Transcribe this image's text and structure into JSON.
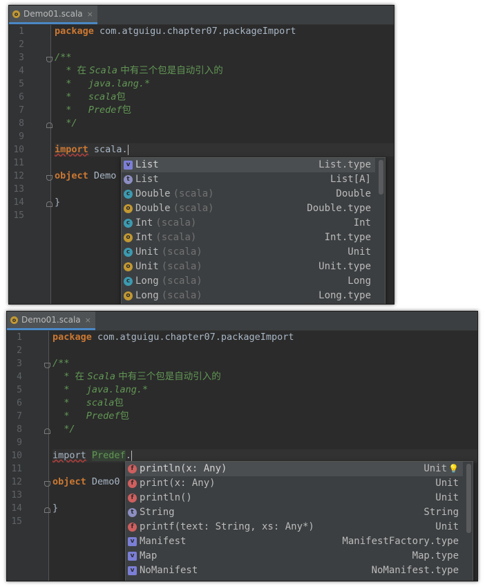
{
  "panels": [
    {
      "tab": {
        "title": "Demo01.scala",
        "icon": "o",
        "close": "×"
      },
      "line_numbers": [
        "1",
        "2",
        "3",
        "4",
        "5",
        "6",
        "7",
        "8",
        "9",
        "10",
        "11",
        "12",
        "13",
        "14",
        "15"
      ],
      "code": {
        "l1_kw": "package",
        "l1_rest": " com.atguigu.chapter07.packageImport",
        "l3": "/**",
        "l4_a": "* ",
        "l4_b": "在 ",
        "l4_c": "Scala",
        "l4_d": " 中有三个包是自动引入的",
        "l5": "*   java.lang.*",
        "l6_a": "*   scala",
        "l6_b": "包",
        "l7_a": "*   Predef",
        "l7_b": "包",
        "l8": "*/",
        "l10_kw": "import",
        "l10_space": " ",
        "l10_typed": "scala.",
        "l12_kw": "object",
        "l12_rest": " Demo",
        "l14": "}"
      },
      "completion": [
        {
          "icon": "v",
          "label": "List",
          "pkg": "",
          "type": "List.type",
          "selected": true
        },
        {
          "icon": "t",
          "label": "List",
          "pkg": "",
          "type": "List[A]"
        },
        {
          "icon": "c",
          "label": "Double",
          "pkg": "(scala)",
          "type": "Double"
        },
        {
          "icon": "o",
          "label": "Double",
          "pkg": "(scala)",
          "type": "Double.type"
        },
        {
          "icon": "c",
          "label": "Int",
          "pkg": "(scala)",
          "type": "Int"
        },
        {
          "icon": "o",
          "label": "Int",
          "pkg": "(scala)",
          "type": "Int.type"
        },
        {
          "icon": "c",
          "label": "Unit",
          "pkg": "(scala)",
          "type": "Unit"
        },
        {
          "icon": "o",
          "label": "Unit",
          "pkg": "(scala)",
          "type": "Unit.type"
        },
        {
          "icon": "c",
          "label": "Long",
          "pkg": "(scala)",
          "type": "Long"
        },
        {
          "icon": "o",
          "label": "Long",
          "pkg": "(scala)",
          "type": "Long.type"
        }
      ]
    },
    {
      "tab": {
        "title": "Demo01.scala",
        "icon": "o",
        "close": "×"
      },
      "line_numbers": [
        "1",
        "2",
        "3",
        "4",
        "5",
        "6",
        "7",
        "8",
        "9",
        "10",
        "11",
        "12",
        "13",
        "14",
        "15"
      ],
      "code": {
        "l1_kw": "package",
        "l1_rest": " com.atguigu.chapter07.packageImport",
        "l3": "/**",
        "l4_a": "* ",
        "l4_b": "在 ",
        "l4_c": "Scala",
        "l4_d": " 中有三个包是自动引入的",
        "l5": "*   java.lang.*",
        "l6_a": "*   scala",
        "l6_b": "包",
        "l7_a": "*   Predef",
        "l7_b": "包",
        "l8": "*/",
        "l10_kw": "import",
        "l10_space": " ",
        "l10_typed": "Predef",
        "l10_dot": ".",
        "l12_kw": "object",
        "l12_rest": " Demo0",
        "l14": "}"
      },
      "completion": [
        {
          "icon": "f",
          "label": "println(x: Any)",
          "type": "Unit",
          "selected": true,
          "bulb": true
        },
        {
          "icon": "f",
          "label": "print(x: Any)",
          "type": "Unit"
        },
        {
          "icon": "f",
          "label": "println()",
          "type": "Unit"
        },
        {
          "icon": "t",
          "label": "String",
          "type": "String"
        },
        {
          "icon": "f",
          "label": "printf(text: String, xs: Any*)",
          "type": "Unit"
        },
        {
          "icon": "v",
          "label": "Manifest",
          "type": "ManifestFactory.type"
        },
        {
          "icon": "v",
          "label": "Map",
          "type": "Map.type"
        },
        {
          "icon": "v",
          "label": "NoManifest",
          "type": "NoManifest.type"
        }
      ]
    }
  ]
}
